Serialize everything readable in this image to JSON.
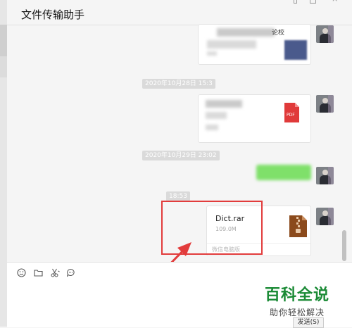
{
  "header": {
    "title": "文件传输助手"
  },
  "messages": {
    "timestamp_1": "2020年10月28日 15:3",
    "timestamp_2": "2020年10月29日 23:02",
    "timestamp_3": "18:53",
    "file_message": {
      "name": "Dict.rar",
      "size": "109.0M",
      "source": "微信电脑版",
      "icon": "rar-archive-icon"
    },
    "pdf_message": {
      "icon": "pdf-icon",
      "icon_label": "PDF"
    },
    "top_message_fragment": "论校"
  },
  "toolbar": {
    "emoji_icon": "emoji-icon",
    "folder_icon": "folder-icon",
    "scissors_icon": "scissors-icon",
    "chat_icon": "chat-bubble-icon",
    "send_label": "发送(S)"
  },
  "watermark": {
    "title": "百科全说",
    "subtitle": "助你轻松解决"
  },
  "colors": {
    "accent_red": "#e23c3c",
    "wechat_green": "#7fe06a",
    "rar_brown": "#8b4a1c",
    "pdf_red": "#e03a3a"
  }
}
